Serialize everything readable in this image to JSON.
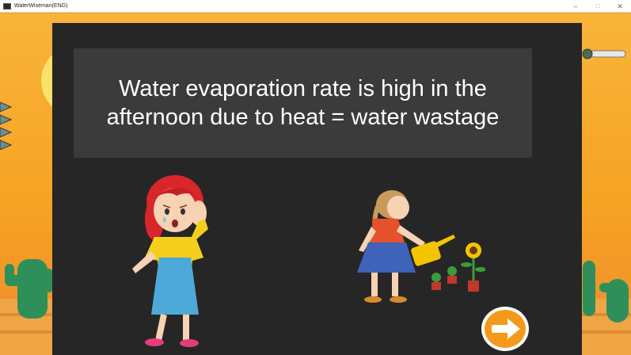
{
  "window": {
    "title": "WaterWiseman(ENG)",
    "minimize_glyph": "–",
    "maximize_glyph": "☐",
    "close_glyph": "✕"
  },
  "panel": {
    "message": "Water evaporation rate is high in the afternoon due to heat = water wastage"
  },
  "illustrations": {
    "left": "worried-girl",
    "right": "girl-watering-plants"
  },
  "next_button": {
    "icon": "arrow-right-icon"
  },
  "colors": {
    "panel": "#262626",
    "text_box": "#3b3b3b",
    "text": "#ffffff",
    "sky": "#f6a323",
    "button": "#f39a1a"
  }
}
